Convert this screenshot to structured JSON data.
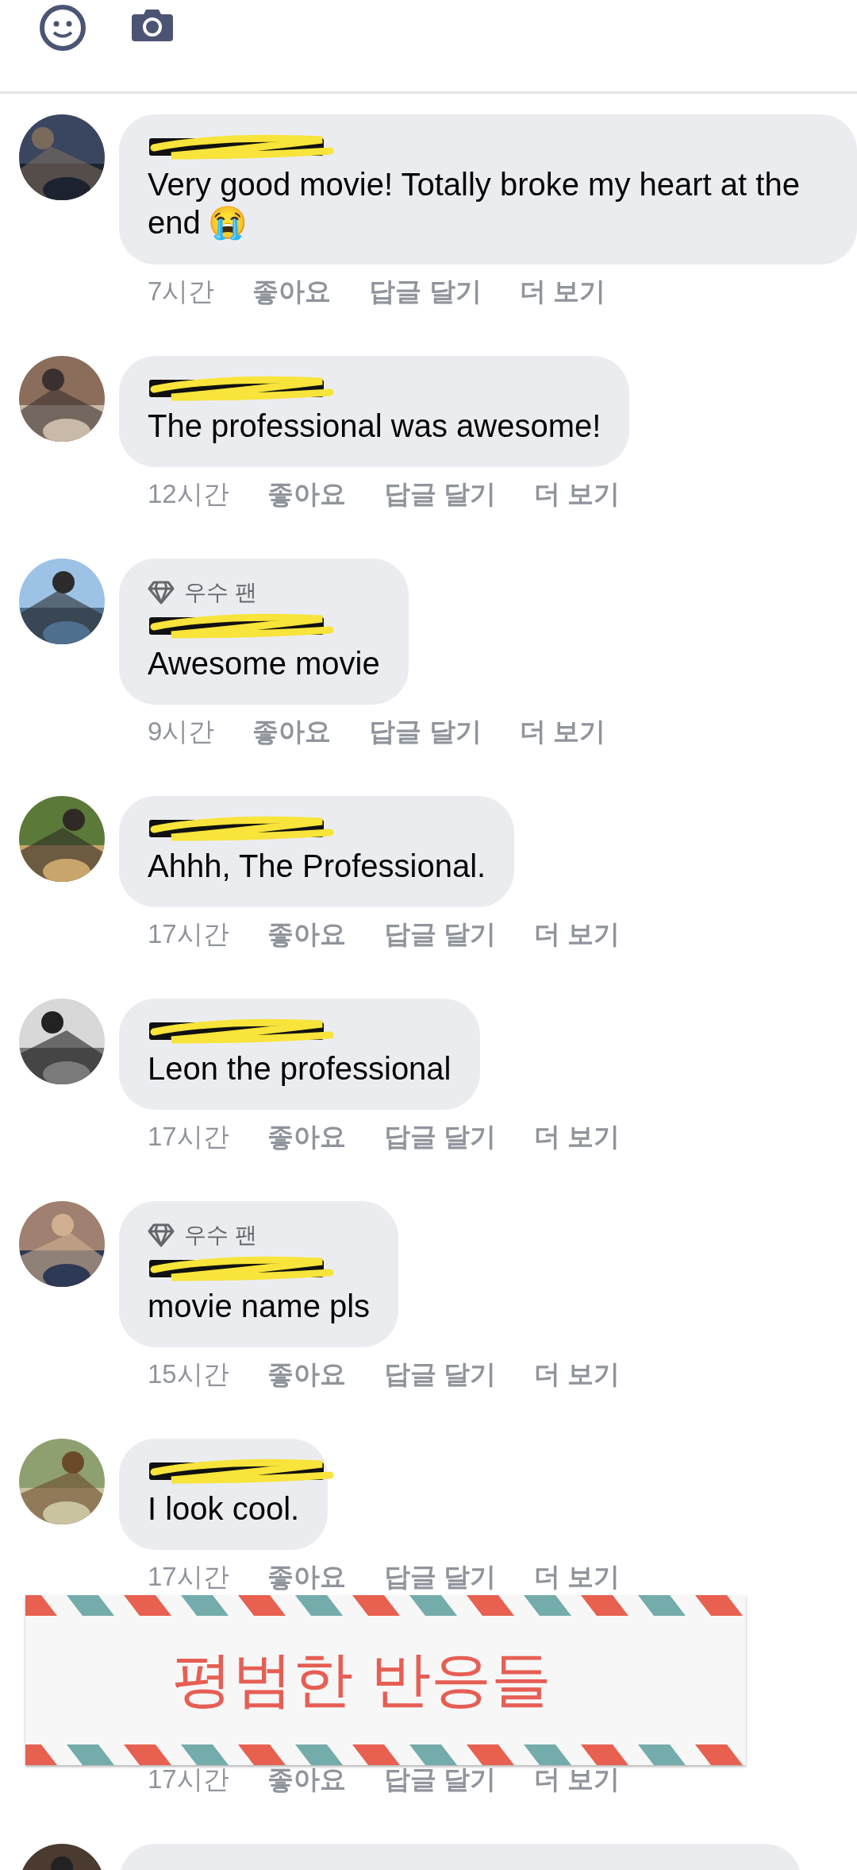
{
  "composer": {
    "tools": [
      {
        "kind": "emoji"
      },
      {
        "kind": "camera"
      }
    ]
  },
  "comments": [
    {
      "kind": "full",
      "text": "Very good movie! Totally broke my heart at the end",
      "emoji": "😭",
      "time": "7시간",
      "actions": [
        "좋아요",
        "답글 달기",
        "더 보기"
      ]
    },
    {
      "kind": "full",
      "text": "The professional was awesome!",
      "time": "12시간",
      "actions": [
        "좋아요",
        "답글 달기",
        "더 보기"
      ]
    },
    {
      "kind": "full",
      "badge": "우수 팬",
      "text": "Awesome movie",
      "time": "9시간",
      "actions": [
        "좋아요",
        "답글 달기",
        "더 보기"
      ]
    },
    {
      "kind": "full",
      "text": "Ahhh, The Professional.",
      "time": "17시간",
      "actions": [
        "좋아요",
        "답글 달기",
        "더 보기"
      ]
    },
    {
      "kind": "full",
      "text": "Leon the professional",
      "time": "17시간",
      "actions": [
        "좋아요",
        "답글 달기",
        "더 보기"
      ]
    },
    {
      "kind": "full",
      "badge": "우수 팬",
      "text": "movie name pls",
      "time": "15시간",
      "actions": [
        "좋아요",
        "답글 달기",
        "더 보기"
      ]
    },
    {
      "kind": "full",
      "text": "I look cool.",
      "time": "17시간",
      "actions": [
        "좋아요",
        "답글 달기",
        "더 보기"
      ]
    },
    {
      "kind": "covered",
      "time": "17시간",
      "actions": [
        "좋아요",
        "답글 달기",
        "더 보기"
      ]
    },
    {
      "kind": "partial"
    }
  ],
  "banner": {
    "title": "평범한 반응들"
  }
}
